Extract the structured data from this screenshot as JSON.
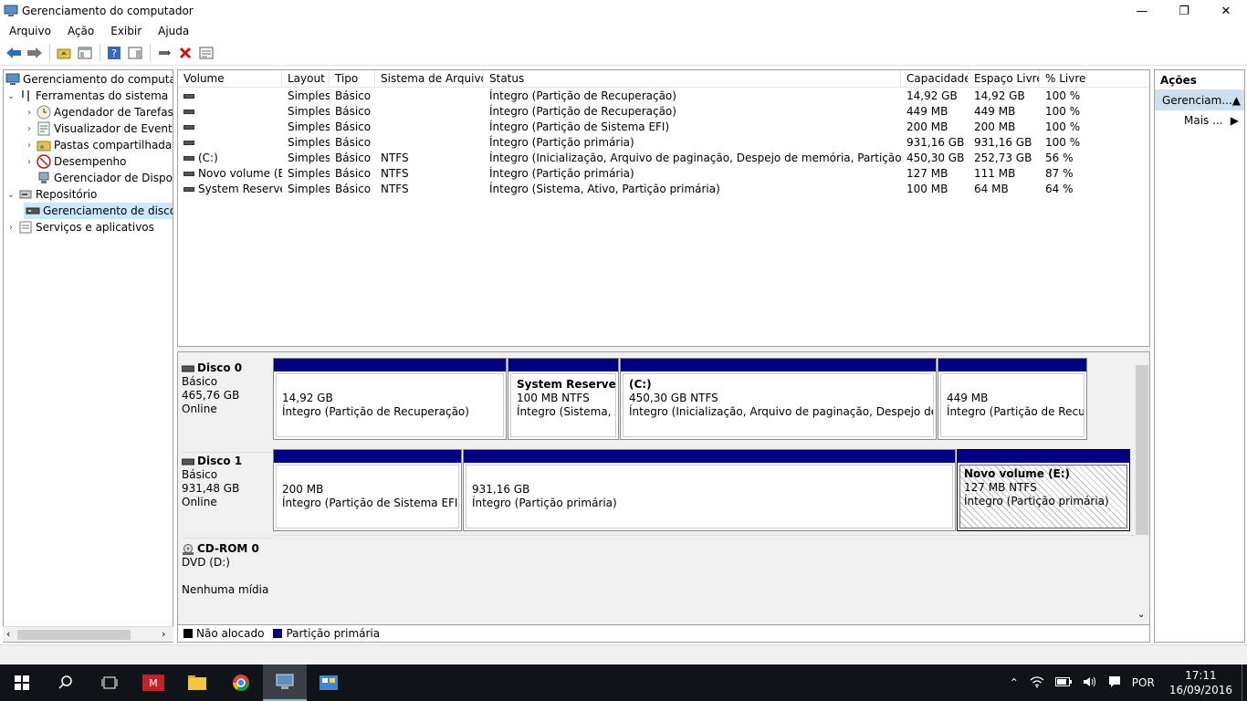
{
  "window": {
    "title": "Gerenciamento do computador",
    "controls": {
      "minimize": "—",
      "maximize": "❐",
      "close": "✕"
    }
  },
  "menu": [
    "Arquivo",
    "Ação",
    "Exibir",
    "Ajuda"
  ],
  "tree": {
    "root": "Gerenciamento do computador",
    "tools": "Ferramentas do sistema",
    "scheduler": "Agendador de Tarefas",
    "events": "Visualizador de Eventos",
    "shared": "Pastas compartilhadas",
    "performance": "Desempenho",
    "devices": "Gerenciador de Disposit",
    "storage": "Repositório",
    "diskmgmt": "Gerenciamento de disco",
    "services": "Serviços e aplicativos"
  },
  "volumes": {
    "headers": [
      "Volume",
      "Layout",
      "Tipo",
      "Sistema de Arquivos",
      "Status",
      "Capacidade",
      "Espaço Livre",
      "% Livre"
    ],
    "rows": [
      {
        "volume": "",
        "layout": "Simples",
        "type": "Básico",
        "fs": "",
        "status": "Íntegro (Partição de Recuperação)",
        "capacity": "14,92 GB",
        "free": "14,92 GB",
        "pct": "100 %"
      },
      {
        "volume": "",
        "layout": "Simples",
        "type": "Básico",
        "fs": "",
        "status": "Íntegro (Partição de Recuperação)",
        "capacity": "449 MB",
        "free": "449 MB",
        "pct": "100 %"
      },
      {
        "volume": "",
        "layout": "Simples",
        "type": "Básico",
        "fs": "",
        "status": "Íntegro (Partição de Sistema EFI)",
        "capacity": "200 MB",
        "free": "200 MB",
        "pct": "100 %"
      },
      {
        "volume": "",
        "layout": "Simples",
        "type": "Básico",
        "fs": "",
        "status": "Íntegro (Partição primária)",
        "capacity": "931,16 GB",
        "free": "931,16 GB",
        "pct": "100 %"
      },
      {
        "volume": "(C:)",
        "layout": "Simples",
        "type": "Básico",
        "fs": "NTFS",
        "status": "Íntegro (Inicialização, Arquivo de paginação, Despejo de memória, Partição primária)",
        "capacity": "450,30 GB",
        "free": "252,73 GB",
        "pct": "56 %"
      },
      {
        "volume": "Novo volume (E:)",
        "layout": "Simples",
        "type": "Básico",
        "fs": "NTFS",
        "status": "Íntegro (Partição primária)",
        "capacity": "127 MB",
        "free": "111 MB",
        "pct": "87 %"
      },
      {
        "volume": "System Reserved",
        "layout": "Simples",
        "type": "Básico",
        "fs": "NTFS",
        "status": "Íntegro (Sistema, Ativo, Partição primária)",
        "capacity": "100 MB",
        "free": "64 MB",
        "pct": "64 %"
      }
    ]
  },
  "disks": [
    {
      "name": "Disco 0",
      "type": "Básico",
      "size": "465,76 GB",
      "state": "Online",
      "parts": [
        {
          "name": "",
          "size": "14,92 GB",
          "status": "Íntegro (Partição de Recuperação)"
        },
        {
          "name": "System Reserved",
          "size": "100 MB NTFS",
          "status": "Íntegro (Sistema, Ativo, Partição primária)"
        },
        {
          "name": "(C:)",
          "size": "450,30 GB NTFS",
          "status": "Íntegro (Inicialização, Arquivo de paginação, Despejo de memória, Partição primária)"
        },
        {
          "name": "",
          "size": "449 MB",
          "status": "Íntegro (Partição de Recuperação)"
        }
      ]
    },
    {
      "name": "Disco 1",
      "type": "Básico",
      "size": "931,48 GB",
      "state": "Online",
      "parts": [
        {
          "name": "",
          "size": "200 MB",
          "status": "Íntegro (Partição de Sistema EFI)"
        },
        {
          "name": "",
          "size": "931,16 GB",
          "status": "Íntegro (Partição primária)"
        },
        {
          "name": "Novo volume  (E:)",
          "size": "127 MB NTFS",
          "status": "Íntegro (Partição primária)"
        }
      ]
    },
    {
      "name": "CD-ROM 0",
      "type": "DVD (D:)",
      "size": "",
      "state": "Nenhuma mídia",
      "parts": []
    }
  ],
  "legend": {
    "unallocated": "Não alocado",
    "primary": "Partição primária",
    "unallocated_color": "#000000",
    "primary_color": "#000080"
  },
  "actions": {
    "header": "Ações",
    "section": "Gerenciam...",
    "more": "Mais ..."
  },
  "taskbar": {
    "lang": "POR",
    "time": "17:11",
    "date": "16/09/2016"
  }
}
